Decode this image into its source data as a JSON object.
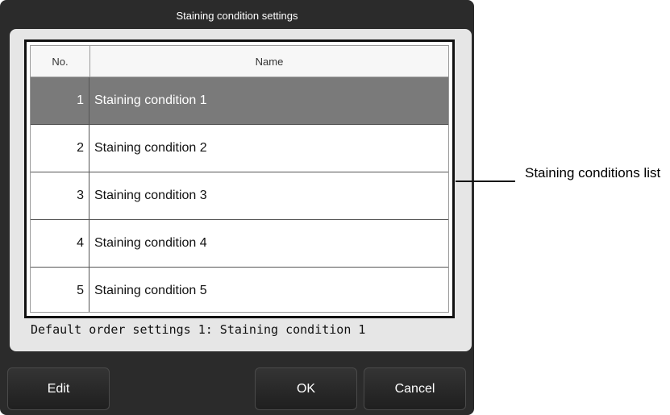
{
  "dialog": {
    "title": "Staining condition settings",
    "columns": {
      "no": "No.",
      "name": "Name"
    },
    "rows": [
      {
        "no": "1",
        "name": "Staining condition 1",
        "selected": true
      },
      {
        "no": "2",
        "name": "Staining condition 2",
        "selected": false
      },
      {
        "no": "3",
        "name": "Staining condition 3",
        "selected": false
      },
      {
        "no": "4",
        "name": "Staining condition 4",
        "selected": false
      },
      {
        "no": "5",
        "name": "Staining condition 5",
        "selected": false
      }
    ],
    "default_order_text": "Default order settings 1: Staining condition 1",
    "buttons": {
      "edit": "Edit",
      "ok": "OK",
      "cancel": "Cancel"
    }
  },
  "annotation": {
    "callout": "Staining conditions list"
  },
  "colors": {
    "dialog_bg": "#2b2b2b",
    "panel_bg": "#e6e6e6",
    "selected_row": "#7a7a7a"
  }
}
